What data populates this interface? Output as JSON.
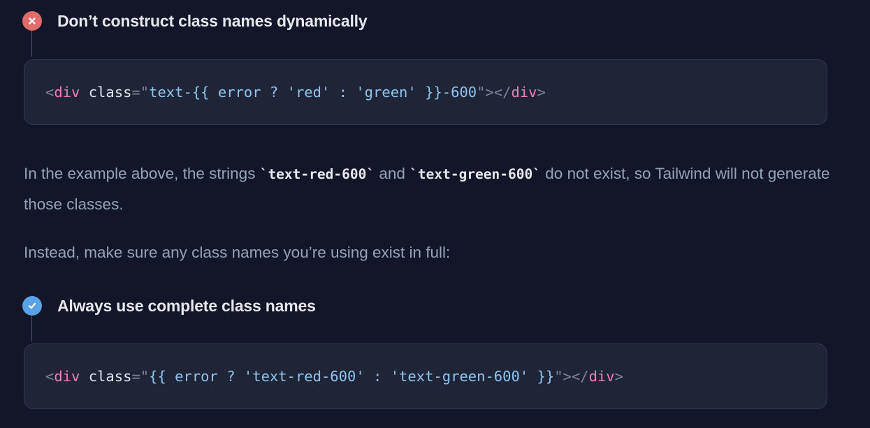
{
  "dont": {
    "title": "Don’t construct class names dynamically",
    "code": {
      "open_lt": "<",
      "tag": "div",
      "space": " ",
      "attr": "class",
      "eq_quote": "=\"",
      "value": "text-{{ error ? 'red' : 'green' }}-600",
      "close_quote_gt": "\">",
      "close_lt": "</",
      "close_tag": "div",
      "close_gt": ">"
    }
  },
  "explanation": {
    "part1": "In the example above, the strings ",
    "code1": "`text-red-600`",
    "part2": " and ",
    "code2": "`text-green-600`",
    "part3": " do not exist, so Tailwind will not generate those classes."
  },
  "instead_text": "Instead, make sure any class names you’re using exist in full:",
  "do": {
    "title": "Always use complete class names",
    "code": {
      "open_lt": "<",
      "tag": "div",
      "space": " ",
      "attr": "class",
      "eq_quote": "=\"",
      "value": "{{ error ? 'text-red-600' : 'text-green-600' }}",
      "close_quote_gt": "\">",
      "close_lt": "</",
      "close_tag": "div",
      "close_gt": ">"
    }
  },
  "icons": {
    "dont": "x-circle-icon",
    "do": "check-circle-icon"
  },
  "colors": {
    "background": "#131629",
    "error_accent": "#e06c6c",
    "success_accent": "#5aa2e6",
    "code_tag": "#f07fb5",
    "code_string": "#8ec5f0"
  }
}
